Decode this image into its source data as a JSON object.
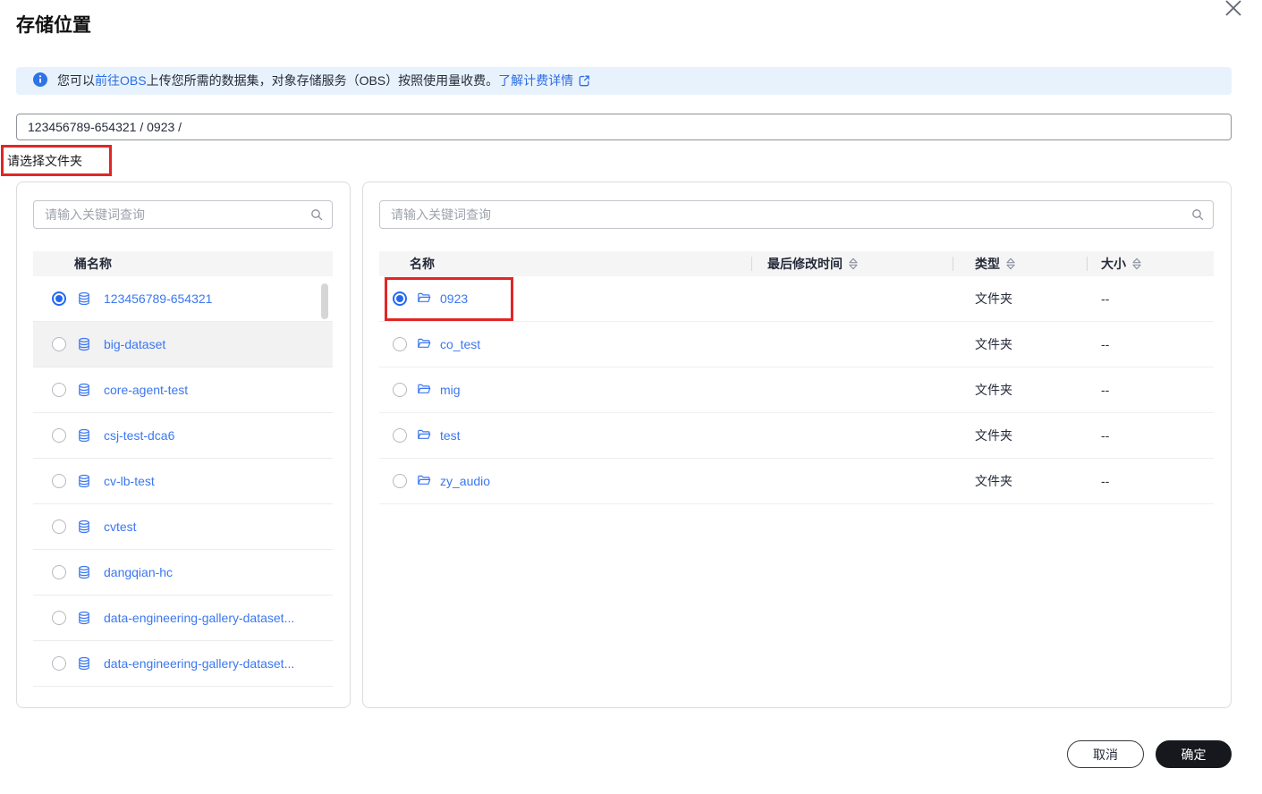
{
  "dialog": {
    "title": "存储位置"
  },
  "banner": {
    "text_before": "您可以",
    "link_obs": "前往OBS",
    "text_middle": "上传您所需的数据集，对象存储服务（OBS）按照使用量收费。",
    "link_pricing": "了解计费详情"
  },
  "path_input": {
    "value": "123456789-654321 / 0923 /"
  },
  "folder_hint": "请选择文件夹",
  "bucket_panel": {
    "search_placeholder": "请输入关键词查询",
    "header": "桶名称",
    "items": [
      {
        "name": "123456789-654321",
        "selected": true,
        "highlight": false
      },
      {
        "name": "big-dataset",
        "selected": false,
        "highlight": true
      },
      {
        "name": "core-agent-test",
        "selected": false,
        "highlight": false
      },
      {
        "name": "csj-test-dca6",
        "selected": false,
        "highlight": false
      },
      {
        "name": "cv-lb-test",
        "selected": false,
        "highlight": false
      },
      {
        "name": "cvtest",
        "selected": false,
        "highlight": false
      },
      {
        "name": "dangqian-hc",
        "selected": false,
        "highlight": false
      },
      {
        "name": "data-engineering-gallery-dataset...",
        "selected": false,
        "highlight": false
      },
      {
        "name": "data-engineering-gallery-dataset...",
        "selected": false,
        "highlight": false
      }
    ]
  },
  "object_panel": {
    "search_placeholder": "请输入关键词查询",
    "columns": [
      {
        "label": "名称",
        "sortable": false
      },
      {
        "label": "最后修改时间",
        "sortable": true
      },
      {
        "label": "类型",
        "sortable": true
      },
      {
        "label": "大小",
        "sortable": true
      }
    ],
    "rows": [
      {
        "name": "0923",
        "selected": true,
        "annotated": true,
        "modified": "",
        "type": "文件夹",
        "size": "--"
      },
      {
        "name": "co_test",
        "selected": false,
        "annotated": false,
        "modified": "",
        "type": "文件夹",
        "size": "--"
      },
      {
        "name": "mig",
        "selected": false,
        "annotated": false,
        "modified": "",
        "type": "文件夹",
        "size": "--"
      },
      {
        "name": "test",
        "selected": false,
        "annotated": false,
        "modified": "",
        "type": "文件夹",
        "size": "--"
      },
      {
        "name": "zy_audio",
        "selected": false,
        "annotated": false,
        "modified": "",
        "type": "文件夹",
        "size": "--"
      }
    ]
  },
  "footer": {
    "cancel_label": "取消",
    "confirm_label": "确定"
  },
  "colors": {
    "accent": "#2468f2",
    "link": "#2b6de5",
    "item-link": "#3b77f0",
    "banner-bg": "#e8f2fc",
    "annotation": "#e02626",
    "confirm-bg": "#17181d"
  }
}
